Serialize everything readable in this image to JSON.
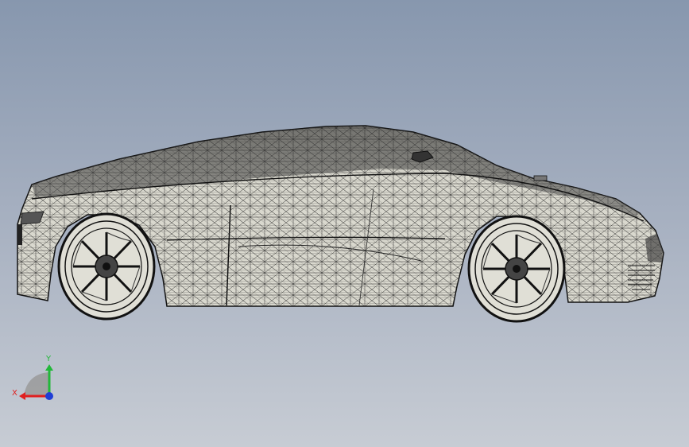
{
  "viewport": {
    "background_top": "#8797ae",
    "background_bottom": "#c7ccd4"
  },
  "model": {
    "subject": "car-wireframe-side-view",
    "surface_color": "#d9d8ce",
    "edge_color": "#1a1a1a"
  },
  "triad": {
    "x_label": "X",
    "y_label": "Y",
    "x_color": "#e02020",
    "y_color": "#22b83a",
    "z_color": "#1f3ed6"
  }
}
